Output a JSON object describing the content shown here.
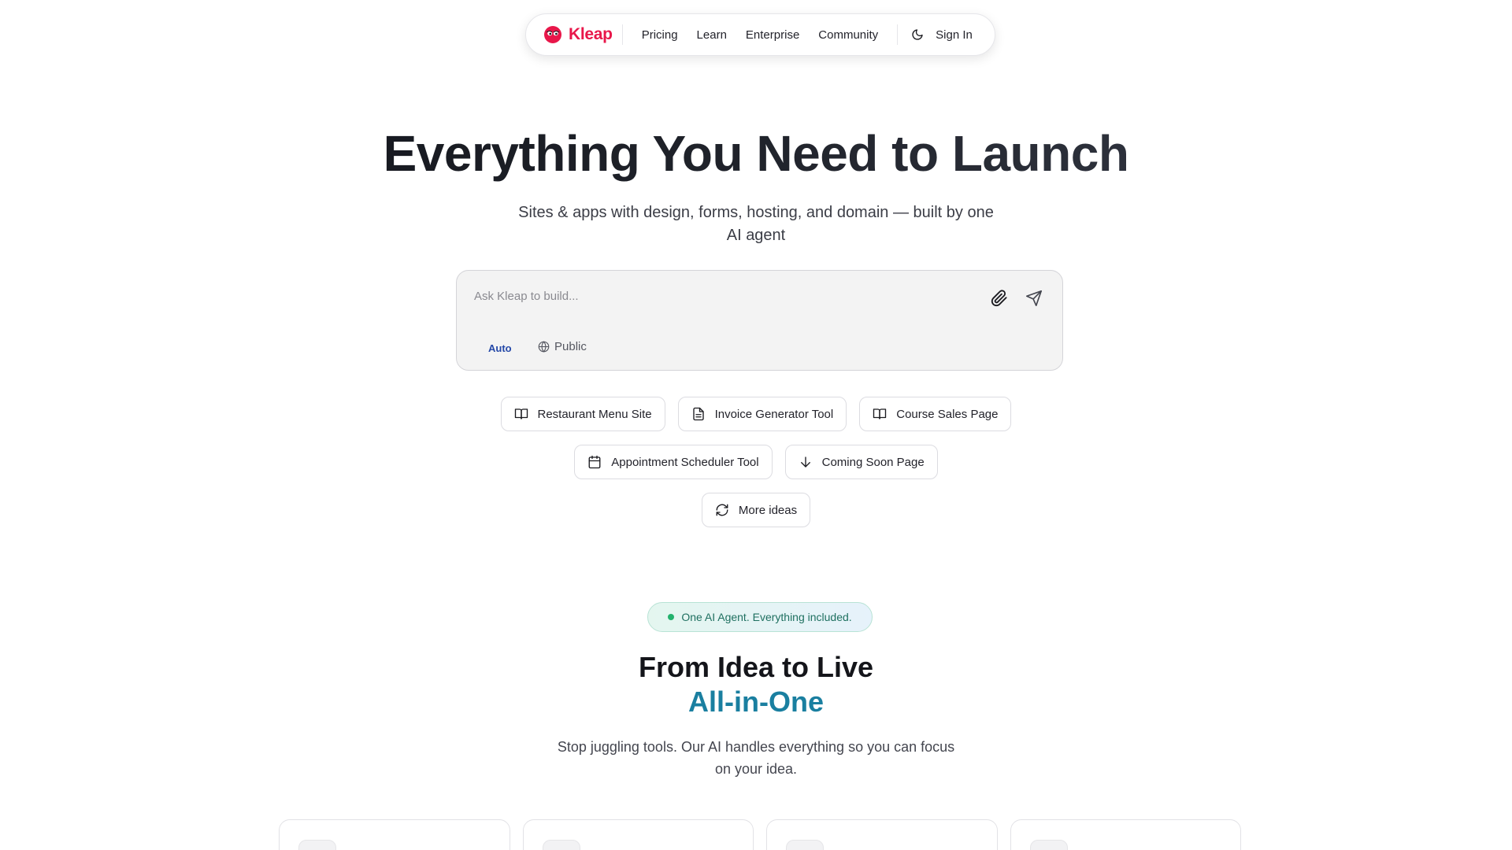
{
  "brand": {
    "name": "Kleap",
    "accent": "#e8174a"
  },
  "nav": {
    "links": [
      {
        "label": "Pricing"
      },
      {
        "label": "Learn"
      },
      {
        "label": "Enterprise"
      },
      {
        "label": "Community"
      }
    ],
    "theme_icon": "moon-icon",
    "signin_label": "Sign In"
  },
  "hero": {
    "title": "Everything You Need to Launch",
    "subtitle": "Sites & apps with design, forms, hosting, and domain — built by one AI agent"
  },
  "prompt": {
    "placeholder": "Ask Kleap to build...",
    "value": "",
    "mode_label": "Auto",
    "visibility_label": "Public",
    "attach_icon": "paperclip-icon",
    "send_icon": "send-icon"
  },
  "chips": {
    "row1": [
      {
        "label": "Restaurant Menu Site",
        "icon": "book-icon"
      },
      {
        "label": "Invoice Generator Tool",
        "icon": "document-icon"
      },
      {
        "label": "Course Sales Page",
        "icon": "book-icon"
      }
    ],
    "row2": [
      {
        "label": "Appointment Scheduler Tool",
        "icon": "calendar-icon"
      },
      {
        "label": "Coming Soon Page",
        "icon": "arrow-down-icon"
      }
    ],
    "row3": [
      {
        "label": "More ideas",
        "icon": "refresh-icon"
      }
    ]
  },
  "features": {
    "badge": "One AI Agent. Everything included.",
    "title_line1": "From Idea to Live",
    "title_line2": "All-in-One",
    "title_accent": "#1a7fa0",
    "subtitle": "Stop juggling tools. Our AI handles everything so you can focus on your idea.",
    "cards": [
      {
        "icon": "pen-icon"
      },
      {
        "icon": "form-icon"
      },
      {
        "icon": "globe-icon"
      },
      {
        "icon": "box-icon"
      }
    ]
  }
}
